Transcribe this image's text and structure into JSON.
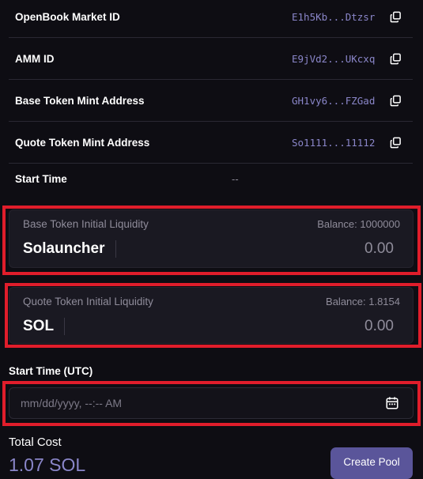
{
  "info_rows": [
    {
      "label": "OpenBook Market ID",
      "value": "E1h5Kb...Dtzsr"
    },
    {
      "label": "AMM ID",
      "value": "E9jVd2...UKcxq"
    },
    {
      "label": "Base Token Mint Address",
      "value": "GH1vy6...FZGad"
    },
    {
      "label": "Quote Token Mint Address",
      "value": "So1111...11112"
    }
  ],
  "start_time_row": {
    "label": "Start Time",
    "value": "--"
  },
  "base_liquidity": {
    "title": "Base Token Initial Liquidity",
    "balance": "Balance: 1000000",
    "token": "Solauncher",
    "amount": "0.00"
  },
  "quote_liquidity": {
    "title": "Quote Token Initial Liquidity",
    "balance": "Balance: 1.8154",
    "token": "SOL",
    "amount": "0.00"
  },
  "start_time_utc": {
    "label": "Start Time (UTC)",
    "placeholder": "mm/dd/yyyy, --:-- AM",
    "icon": "calendar-icon"
  },
  "total": {
    "label": "Total Cost",
    "value": "1.07 SOL"
  },
  "create_button": {
    "label": "Create Pool"
  },
  "colors": {
    "background": "#0e0d13",
    "accent_text": "#8a86c9",
    "button": "#5a559a",
    "highlight": "#e01d2b"
  }
}
